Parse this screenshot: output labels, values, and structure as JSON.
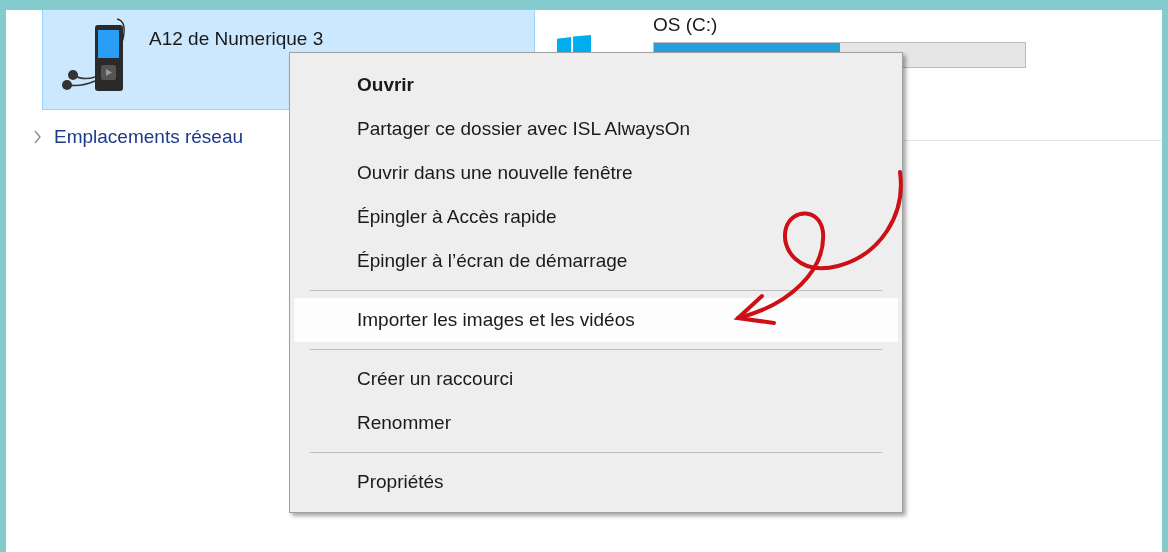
{
  "device": {
    "name": "A12 de Numerique 3",
    "selected": true
  },
  "drive": {
    "name": "OS (C:)",
    "level": 0.5
  },
  "navigation": {
    "label": "Emplacements réseau",
    "expanded": false
  },
  "context_menu": {
    "items": [
      {
        "kind": "item",
        "label": "Ouvrir",
        "default": true,
        "selected": false
      },
      {
        "kind": "item",
        "label": "Partager ce dossier avec ISL AlwaysOn",
        "default": false,
        "selected": false
      },
      {
        "kind": "item",
        "label": "Ouvrir dans une nouvelle fenêtre",
        "default": false,
        "selected": false
      },
      {
        "kind": "item",
        "label": "Épingler à Accès rapide",
        "default": false,
        "selected": false
      },
      {
        "kind": "item",
        "label": "Épingler à l’écran de démarrage",
        "default": false,
        "selected": false
      },
      {
        "kind": "separator"
      },
      {
        "kind": "item",
        "label": "Importer les images et les vidéos",
        "default": false,
        "selected": true
      },
      {
        "kind": "separator"
      },
      {
        "kind": "item",
        "label": "Créer un raccourci",
        "default": false,
        "selected": false
      },
      {
        "kind": "item",
        "label": "Renommer",
        "default": false,
        "selected": false
      },
      {
        "kind": "separator"
      },
      {
        "kind": "item",
        "label": "Propriétés",
        "default": false,
        "selected": false
      }
    ]
  }
}
